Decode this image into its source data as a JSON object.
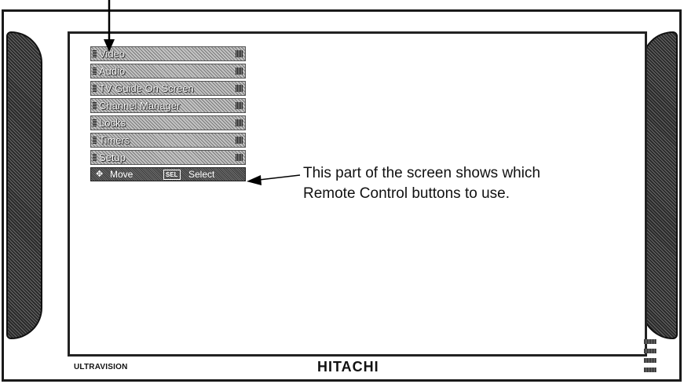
{
  "menu": {
    "items": [
      {
        "label": "Video"
      },
      {
        "label": "Audio"
      },
      {
        "label": "TV Guide On Screen"
      },
      {
        "label": "Channel Manager"
      },
      {
        "label": "Locks"
      },
      {
        "label": "Timers"
      },
      {
        "label": "Setup"
      }
    ],
    "hint": {
      "move_label": "Move",
      "select_key": "SEL",
      "select_label": "Select"
    }
  },
  "annotation": {
    "line1": "This part of the screen shows which",
    "line2": "Remote Control buttons to use."
  },
  "brand": {
    "left": "ULTRAVISION",
    "center": "HITACHI"
  }
}
